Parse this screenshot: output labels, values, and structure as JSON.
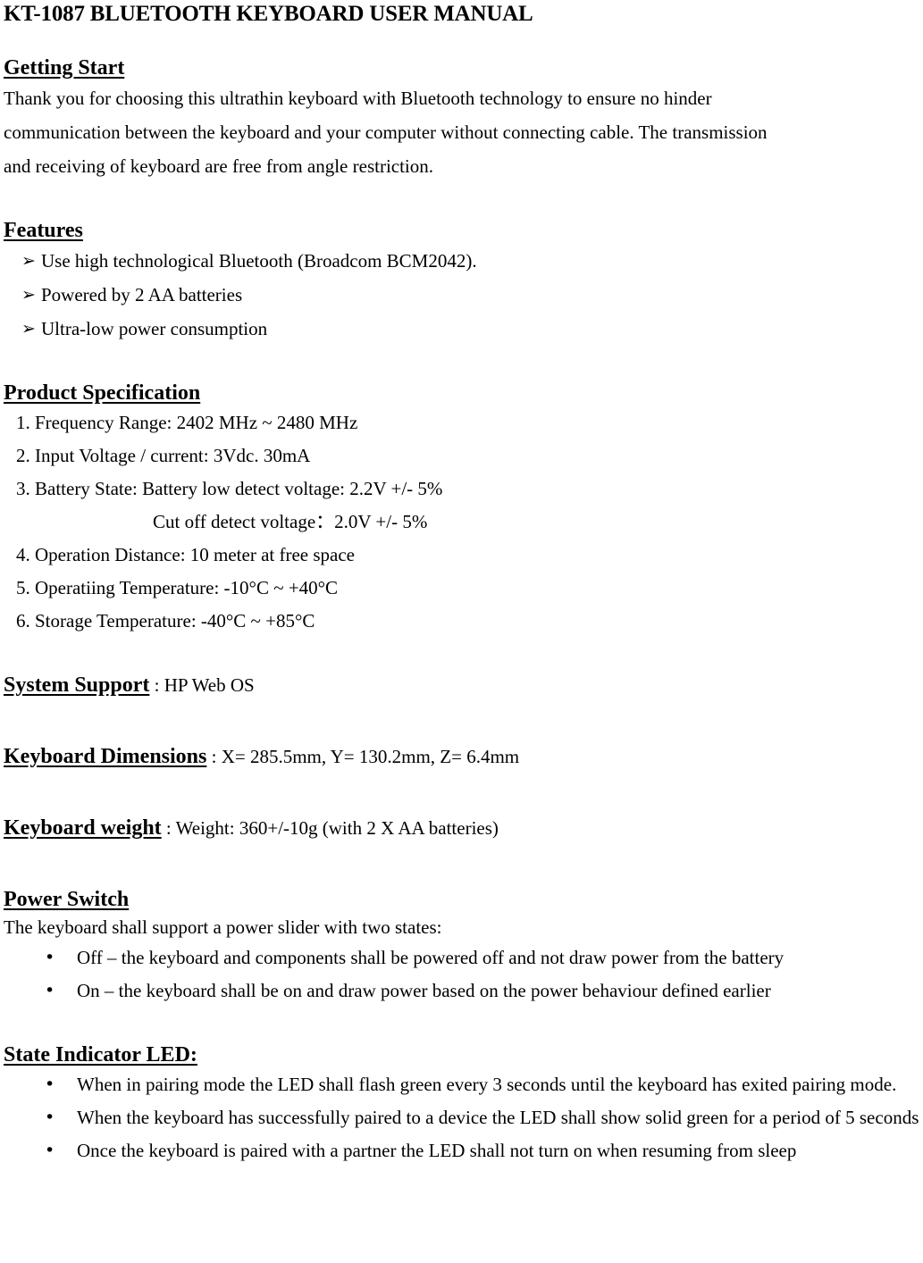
{
  "document": {
    "title": "KT-1087 BLUETOOTH KEYBOARD USER MANUAL"
  },
  "getting_start": {
    "heading": "Getting Start",
    "paragraph_lines": [
      "Thank you for choosing this ultrathin keyboard with Bluetooth technology to ensure no hinder",
      "communication between the keyboard and your computer without connecting cable. The transmission",
      "and receiving of keyboard are free from angle restriction."
    ]
  },
  "features": {
    "heading": "Features",
    "bullet_glyph": "➢",
    "items": [
      "Use high technological Bluetooth (Broadcom BCM2042).",
      "Powered by 2 AA batteries",
      "Ultra-low power consumption"
    ]
  },
  "product_specification": {
    "heading": "Product Specification",
    "items": [
      "1. Frequency Range: 2402 MHz ~ 2480 MHz",
      "2. Input Voltage / current: 3Vdc. 30mA",
      "3. Battery State: Battery low detect voltage: 2.2V +/- 5%",
      "4. Operation Distance: 10 meter at free space",
      "5. Operatiing Temperature: -10°C ~ +40°C",
      "6. Storage Temperature: -40°C ~ +85°C"
    ],
    "sub_line": "Cut off detect voltage：2.0V +/- 5%"
  },
  "system_support": {
    "heading": "System Support",
    "separator": " : ",
    "value": "HP Web OS"
  },
  "keyboard_dimensions": {
    "heading": "Keyboard Dimensions",
    "separator": " : ",
    "value": "X= 285.5mm, Y= 130.2mm, Z= 6.4mm"
  },
  "keyboard_weight": {
    "heading": "Keyboard weight",
    "separator": " : ",
    "value": "Weight: 360+/-10g (with 2 X AA batteries)"
  },
  "power_switch": {
    "heading": "Power Switch",
    "intro": "The keyboard shall support a power slider with two states:",
    "bullet_glyph": "•",
    "items": [
      "Off – the keyboard and components shall be powered off and not draw power from the battery",
      "On – the keyboard shall be on and draw power based on the power behaviour defined earlier"
    ]
  },
  "state_indicator_led": {
    "heading": "State Indicator LED:",
    "bullet_glyph": "•",
    "items": [
      "When in pairing mode the LED shall flash green every 3 seconds until the keyboard has exited pairing mode.",
      "When the keyboard has successfully paired to a device the LED shall show solid green for a period of 5 seconds",
      "Once the keyboard is paired with a partner the LED shall not turn on when resuming from sleep"
    ]
  }
}
